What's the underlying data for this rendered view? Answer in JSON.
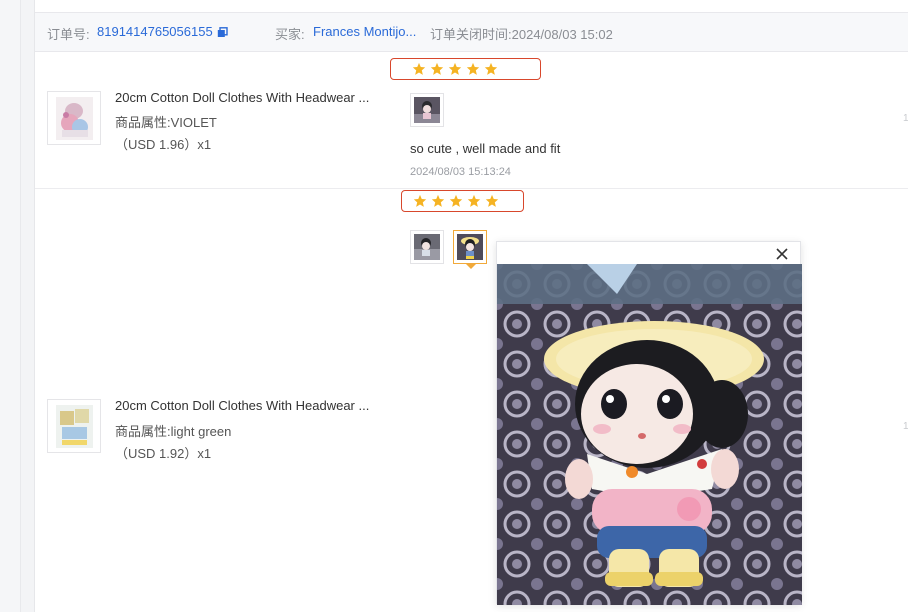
{
  "order": {
    "label": "订单号:",
    "number": "8191414765056155",
    "buyer_label": "买家:",
    "buyer_name": "Frances Montijo...",
    "close_time_label": "订单关闭时间:",
    "close_time": "2024/08/03 15:02"
  },
  "items": [
    {
      "title": "20cm Cotton Doll Clothes With Headwear ...",
      "attr_label": "商品属性:",
      "attr_value": "VIOLET",
      "price": "（USD  1.96）x1",
      "rating": 5,
      "review_text": "so cute , well made and fit",
      "review_time": "2024/08/03 15:13:24",
      "right_mark": "1"
    },
    {
      "title": "20cm Cotton Doll Clothes With Headwear ...",
      "attr_label": "商品属性:",
      "attr_value": "light green",
      "price": "（USD  1.92）x1",
      "rating": 5,
      "right_mark": "1"
    }
  ],
  "colors": {
    "star": "#f5b323",
    "highlight_border": "#d8472c",
    "link": "#2a6ad8",
    "selected_border": "#f1a93a"
  },
  "icons": {
    "copy": "copy-icon",
    "close": "close-icon",
    "star": "star-icon"
  }
}
